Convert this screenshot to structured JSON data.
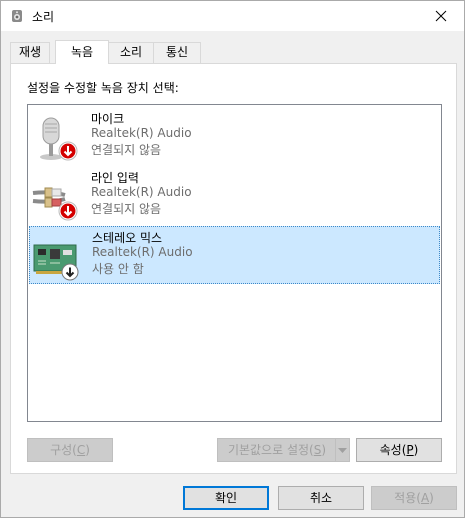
{
  "window": {
    "title": "소리"
  },
  "tabs": [
    {
      "label": "재생"
    },
    {
      "label": "녹음"
    },
    {
      "label": "소리"
    },
    {
      "label": "통신"
    }
  ],
  "prompt": "설정을 수정할 녹음 장치 선택:",
  "devices": [
    {
      "name": "마이크",
      "driver": "Realtek(R) Audio",
      "status": "연결되지 않음",
      "icon": "microphone-icon"
    },
    {
      "name": "라인 입력",
      "driver": "Realtek(R) Audio",
      "status": "연결되지 않음",
      "icon": "line-in-icon"
    },
    {
      "name": "스테레오 믹스",
      "driver": "Realtek(R) Audio",
      "status": "사용 안 함",
      "icon": "sound-card-icon",
      "selected": true
    }
  ],
  "buttons": {
    "configure": {
      "label": "구성",
      "key": "C"
    },
    "set_default": {
      "label": "기본값으로 설정",
      "key": "S"
    },
    "properties": {
      "label": "속성",
      "key": "P"
    },
    "ok": "확인",
    "cancel": "취소",
    "apply": {
      "label": "적용",
      "key": "A"
    }
  },
  "colors": {
    "selection": "#cce8ff",
    "status_badge_red": "#d40000",
    "status_badge_dark": "#222222"
  }
}
